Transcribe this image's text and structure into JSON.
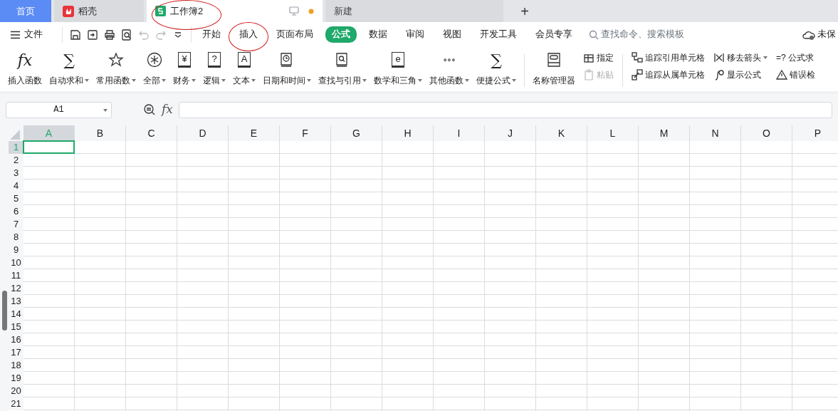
{
  "tabs": [
    {
      "label": "首页",
      "kind": "home",
      "selected": false,
      "circled": false,
      "unsaved": false
    },
    {
      "label": "稻壳",
      "kind": "docer",
      "selected": false,
      "circled": false,
      "unsaved": false
    },
    {
      "label": "工作簿2",
      "kind": "sheet",
      "selected": true,
      "circled": true,
      "unsaved": true
    },
    {
      "label": "新建",
      "kind": "new",
      "selected": false,
      "circled": false,
      "unsaved": false
    }
  ],
  "new_tab_button": "+",
  "file_menu": "文件",
  "menu": [
    {
      "label": "开始",
      "selected": false,
      "circled": false
    },
    {
      "label": "插入",
      "selected": false,
      "circled": true
    },
    {
      "label": "页面布局",
      "selected": false,
      "circled": false
    },
    {
      "label": "公式",
      "selected": true,
      "circled": false
    },
    {
      "label": "数据",
      "selected": false,
      "circled": false
    },
    {
      "label": "审阅",
      "selected": false,
      "circled": false
    },
    {
      "label": "视图",
      "selected": false,
      "circled": false
    },
    {
      "label": "开发工具",
      "selected": false,
      "circled": false
    },
    {
      "label": "会员专享",
      "selected": false,
      "circled": false
    }
  ],
  "search": {
    "placeholder": "查找命令、搜索模板"
  },
  "save_status": "未保",
  "ribbon": {
    "large": [
      {
        "label": "插入函数",
        "dropdown": false,
        "glyph": "fx"
      },
      {
        "label": "自动求和",
        "dropdown": true,
        "glyph": "∑"
      },
      {
        "label": "常用函数",
        "dropdown": true
      },
      {
        "label": "全部",
        "dropdown": true
      },
      {
        "label": "财务",
        "dropdown": true,
        "glyph": "¥"
      },
      {
        "label": "逻辑",
        "dropdown": true,
        "glyph": "?"
      },
      {
        "label": "文本",
        "dropdown": true,
        "glyph": "A"
      },
      {
        "label": "日期和时间",
        "dropdown": true
      },
      {
        "label": "查找与引用",
        "dropdown": true
      },
      {
        "label": "数学和三角",
        "dropdown": true,
        "glyph": "e"
      },
      {
        "label": "其他函数",
        "dropdown": true,
        "glyph": "∘∘∘"
      },
      {
        "label": "便捷公式",
        "dropdown": true,
        "glyph": "∑"
      }
    ],
    "name_manager": "名称管理器",
    "small": [
      {
        "label": "指定",
        "disabled": false
      },
      {
        "label": "粘贴",
        "disabled": true
      }
    ],
    "audit": [
      {
        "label": "追踪引用单元格",
        "dropdown": false
      },
      {
        "label": "追踪从属单元格",
        "dropdown": false
      },
      {
        "label": "移去箭头",
        "dropdown": true
      },
      {
        "label": "显示公式",
        "dropdown": false
      },
      {
        "label": "公式求",
        "dropdown": false,
        "glyph": "=?"
      },
      {
        "label": "错误检",
        "dropdown": false
      }
    ]
  },
  "name_box": {
    "value": "A1"
  },
  "formula_label": "fx",
  "columns": [
    {
      "label": "A",
      "selected": true
    },
    {
      "label": "B",
      "selected": false
    },
    {
      "label": "C",
      "selected": false
    },
    {
      "label": "D",
      "selected": false
    },
    {
      "label": "E",
      "selected": false
    },
    {
      "label": "F",
      "selected": false
    },
    {
      "label": "G",
      "selected": false
    },
    {
      "label": "H",
      "selected": false
    },
    {
      "label": "I",
      "selected": false
    },
    {
      "label": "J",
      "selected": false
    },
    {
      "label": "K",
      "selected": false
    },
    {
      "label": "L",
      "selected": false
    },
    {
      "label": "M",
      "selected": false
    },
    {
      "label": "N",
      "selected": false
    },
    {
      "label": "O",
      "selected": false
    },
    {
      "label": "P",
      "selected": false
    }
  ],
  "rows": [
    {
      "label": "1",
      "selected": true
    },
    {
      "label": "2",
      "selected": false
    },
    {
      "label": "3",
      "selected": false
    },
    {
      "label": "4",
      "selected": false
    },
    {
      "label": "5",
      "selected": false
    },
    {
      "label": "6",
      "selected": false
    },
    {
      "label": "7",
      "selected": false
    },
    {
      "label": "8",
      "selected": false
    },
    {
      "label": "9",
      "selected": false
    },
    {
      "label": "10",
      "selected": false
    },
    {
      "label": "11",
      "selected": false
    },
    {
      "label": "12",
      "selected": false
    },
    {
      "label": "13",
      "selected": false
    },
    {
      "label": "14",
      "selected": false
    },
    {
      "label": "15",
      "selected": false
    },
    {
      "label": "16",
      "selected": false
    },
    {
      "label": "17",
      "selected": false
    },
    {
      "label": "18",
      "selected": false
    },
    {
      "label": "19",
      "selected": false
    },
    {
      "label": "20",
      "selected": false
    },
    {
      "label": "21",
      "selected": false
    }
  ]
}
